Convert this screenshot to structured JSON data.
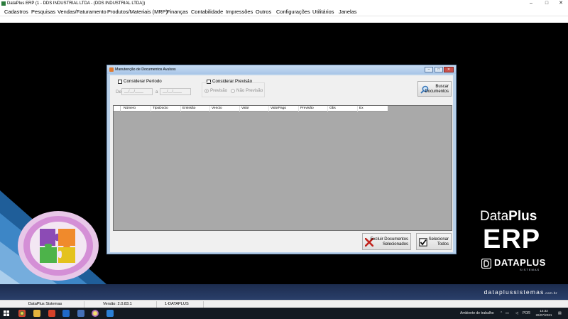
{
  "window": {
    "title": "DataPlus ERP (1 - DDS INDUSTRIAL LTDA - (DDS INDUSTRIAL LTDA))",
    "controls": [
      "–",
      "□",
      "✕"
    ]
  },
  "menu": [
    "Cadastros",
    "Pesquisas",
    "Vendas/Faturamento",
    "Produtos/Materiais (MRP)",
    "Finanças",
    "Contabilidade",
    "Impressões",
    "Outros",
    "Configurações",
    "Utilitários",
    "Janelas"
  ],
  "dialog": {
    "title": "Manutenção de Documentos Avulsos",
    "controls": [
      "–",
      "□",
      "✕"
    ],
    "periodo": {
      "checkbox_label": "Considerar Período",
      "checked": false,
      "from_label": "De",
      "from_value": "__/__/____",
      "to_label": "a",
      "to_value": "__/__/____"
    },
    "previsao": {
      "checkbox_label": "Considerar Previsão",
      "checked": false,
      "options": [
        "Previsão",
        "Não Previsão"
      ],
      "selected": "Previsão"
    },
    "buscar_button": {
      "line1": "Buscar",
      "line2": "Documentos",
      "icon": "search-icon"
    },
    "grid": {
      "columns": [
        "Número",
        "TipoDocto",
        "Emissão",
        "Vencto",
        "Valor",
        "ValorPago",
        "Previsão",
        "Obs",
        "Ex"
      ],
      "rows": []
    },
    "excluir_button": {
      "line1": "Excluir Documentos",
      "line2": "Selecionados",
      "icon": "delete-x-icon"
    },
    "selecionar_button": {
      "line1": "Selecionar",
      "line2": "Todos",
      "icon": "checkmark-icon"
    }
  },
  "brand": {
    "dataplus_light": "Data",
    "dataplus_bold": "Plus",
    "erp": "ERP",
    "company": "DATAPLUS",
    "company_sub": "SISTEMAS",
    "site": "dataplussistemas",
    "site_tld": ".com.br"
  },
  "statusbar": {
    "company": "DataPlus Sistemas",
    "version": "Versão: 2.0.83.1",
    "user": "1-DATAPLUS"
  },
  "taskbar": {
    "tray_text": "Ambiente de trabalho",
    "language": "POR",
    "time": "14:32",
    "date": "26/07/2021"
  },
  "colors": {
    "dialog_frame": "#b9d1ea",
    "grid_background": "#a9a9a9",
    "brand_band": "#24365c"
  }
}
